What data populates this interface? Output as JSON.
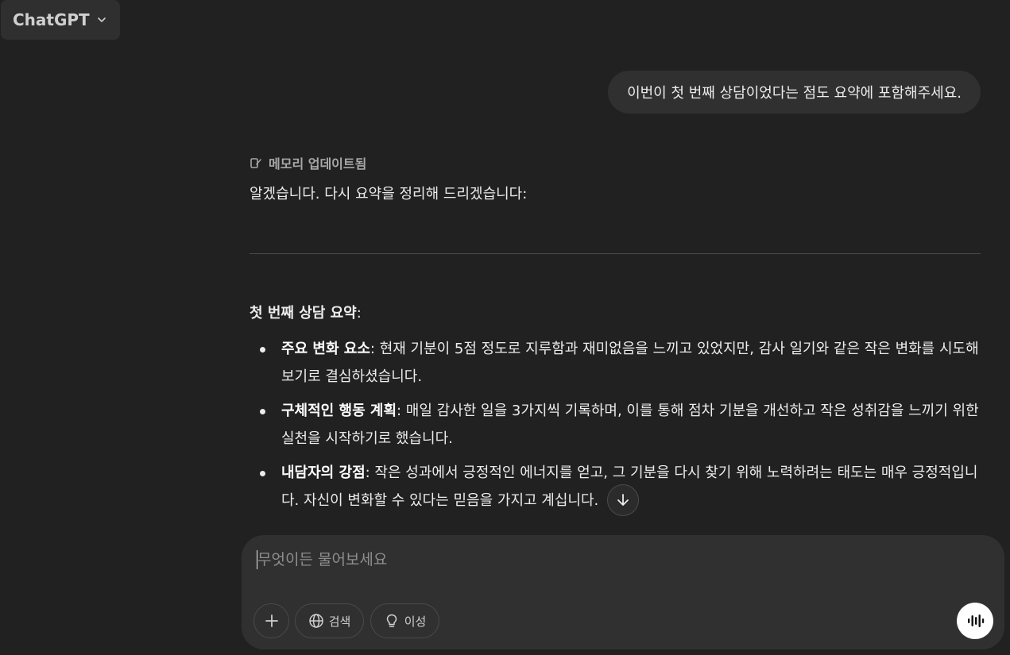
{
  "header": {
    "model_label": "ChatGPT"
  },
  "user_message": "이번이 첫 번째 상담이었다는 점도 요약에 포함해주세요.",
  "assistant": {
    "memory_label": "메모리 업데이트됨",
    "intro": "알겠습니다. 다시 요약을 정리해 드리겠습니다:",
    "section_title": "첫 번째 상담 요약",
    "section_colon": ":",
    "points": [
      {
        "title": "주요 변화 요소",
        "text": ": 현재 기분이 5점 정도로 지루함과 재미없음을 느끼고 있었지만, 감사 일기와 같은 작은 변화를 시도해 보기로 결심하셨습니다."
      },
      {
        "title": "구체적인 행동 계획",
        "text": ": 매일 감사한 일을 3가지씩 기록하며, 이를 통해 점차 기분을 개선하고 작은 성취감을 느끼기 위한 실천을 시작하기로 했습니다."
      },
      {
        "title": "내담자의 강점",
        "text": ": 작은 성과에서 긍정적인 에너지를 얻고, 그 기분을 다시 찾기 위해 노력하려는 태도는 매우 긍정적입니다. 자신이 변화할 수 있다는 믿음을 가지고 계십니다."
      }
    ]
  },
  "composer": {
    "placeholder": "무엇이든 물어보세요",
    "value": "",
    "search_label": "검색",
    "reason_label": "이성"
  },
  "icons": {
    "chevron": "chevron-down-icon",
    "memory": "memory-edit-icon",
    "scroll": "arrow-down-icon",
    "plus": "plus-icon",
    "globe": "globe-icon",
    "bulb": "lightbulb-icon",
    "voice": "voice-waveform-icon"
  }
}
